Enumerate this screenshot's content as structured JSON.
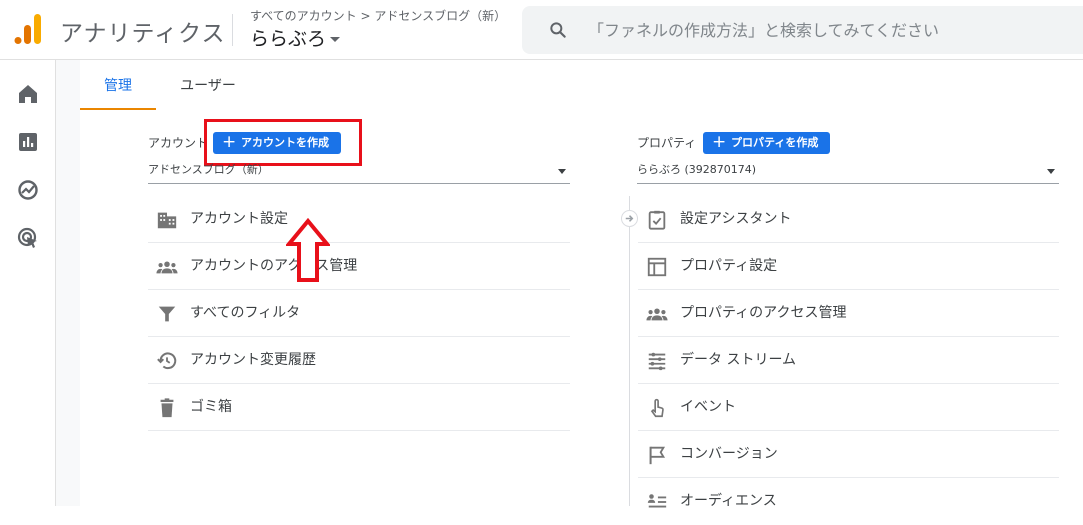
{
  "header": {
    "app_title": "アナリティクス",
    "breadcrumb": "すべてのアカウント > アドセンスブログ（新）",
    "property_name": "ららぶろ",
    "search_placeholder": "「ファネルの作成方法」と検索してみてください"
  },
  "leftnav": {
    "items": [
      {
        "icon": "home-icon"
      },
      {
        "icon": "reports-icon"
      },
      {
        "icon": "explore-icon"
      },
      {
        "icon": "advertising-icon"
      }
    ]
  },
  "tabs": [
    {
      "label": "管理",
      "active": true
    },
    {
      "label": "ユーザー",
      "active": false
    }
  ],
  "account_column": {
    "label": "アカウント",
    "create_button": "アカウントを作成",
    "selected": "アドセンスブログ（新）",
    "items": [
      {
        "label": "アカウント設定",
        "icon": "building-icon"
      },
      {
        "label": "アカウントのアクセス管理",
        "icon": "people-icon"
      },
      {
        "label": "すべてのフィルタ",
        "icon": "filter-icon"
      },
      {
        "label": "アカウント変更履歴",
        "icon": "history-icon"
      },
      {
        "label": "ゴミ箱",
        "icon": "trash-icon"
      }
    ]
  },
  "property_column": {
    "label": "プロパティ",
    "create_button": "プロパティを作成",
    "selected": "ららぶろ (392870174)",
    "items": [
      {
        "label": "設定アシスタント",
        "icon": "checklist-icon"
      },
      {
        "label": "プロパティ設定",
        "icon": "layout-icon"
      },
      {
        "label": "プロパティのアクセス管理",
        "icon": "people-icon"
      },
      {
        "label": "データ ストリーム",
        "icon": "streams-icon"
      },
      {
        "label": "イベント",
        "icon": "touch-icon"
      },
      {
        "label": "コンバージョン",
        "icon": "flag-icon"
      },
      {
        "label": "オーディエンス",
        "icon": "audience-icon"
      }
    ]
  },
  "colors": {
    "accent": "#1a73e8",
    "tab_underline": "#ea8600",
    "annotation_red": "#e8101a"
  }
}
